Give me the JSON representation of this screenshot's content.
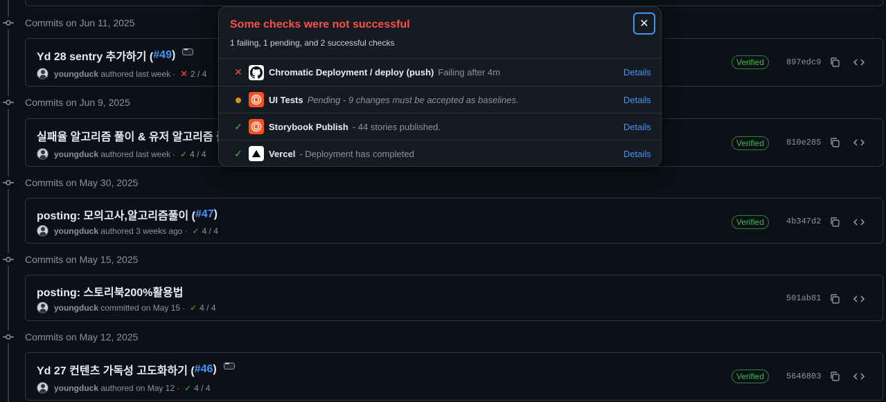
{
  "groups": [
    {
      "label": "Commits on Jun 11, 2025"
    },
    {
      "label": "Commits on Jun 9, 2025"
    },
    {
      "label": "Commits on May 30, 2025"
    },
    {
      "label": "Commits on May 15, 2025"
    },
    {
      "label": "Commits on May 12, 2025"
    }
  ],
  "commits": [
    {
      "title": "Yd 28 sentry 추가하기 (",
      "pr": "#49",
      "title_end": ")",
      "author": "youngduck",
      "action": "authored",
      "time": "last week",
      "sep": "·",
      "status": "fail",
      "checks": "2 / 4",
      "verified": "Verified",
      "sha": "897edc9"
    },
    {
      "title": "실패율 알고리즘 풀이 & 유저 알고리즘 풀",
      "pr": "",
      "title_end": "",
      "author": "youngduck",
      "action": "authored",
      "time": "last week",
      "sep": "·",
      "status": "success",
      "checks": "4 / 4",
      "verified": "Verified",
      "sha": "810e285"
    },
    {
      "title": "posting: 모의고사,알고리즘풀이 (",
      "pr": "#47",
      "title_end": ")",
      "author": "youngduck",
      "action": "authored",
      "time": "3 weeks ago",
      "sep": "·",
      "status": "success",
      "checks": "4 / 4",
      "verified": "Verified",
      "sha": "4b347d2"
    },
    {
      "title": "posting: 스토리북200%활용법",
      "pr": "",
      "title_end": "",
      "author": "youngduck",
      "action": "committed",
      "time": "on May 15",
      "sep": "·",
      "status": "success",
      "checks": "4 / 4",
      "verified": "",
      "sha": "501ab81"
    },
    {
      "title": "Yd 27 컨텐츠 가독성 고도화하기 (",
      "pr": "#46",
      "title_end": ")",
      "author": "youngduck",
      "action": "authored",
      "time": "on May 12",
      "sep": "·",
      "status": "success",
      "checks": "4 / 4",
      "verified": "Verified",
      "sha": "5646803"
    }
  ],
  "popover": {
    "title": "Some checks were not successful",
    "subtitle": "1 failing, 1 pending, and 2 successful checks",
    "close_icon": "x-icon",
    "checks": [
      {
        "status": "fail",
        "icon": "github-icon",
        "name": "Chromatic Deployment / deploy (push)",
        "desc": "Failing after 4m",
        "italic": false,
        "details": "Details"
      },
      {
        "status": "pending",
        "icon": "chromatic-icon",
        "name": "UI Tests",
        "desc": "Pending - 9 changes must be accepted as baselines.",
        "italic": true,
        "details": "Details"
      },
      {
        "status": "success",
        "icon": "chromatic-icon",
        "name": "Storybook Publish",
        "desc": "- 44 stories published.",
        "italic": false,
        "details": "Details"
      },
      {
        "status": "success",
        "icon": "vercel-icon",
        "name": "Vercel",
        "desc": "- Deployment has completed",
        "italic": false,
        "details": "Details"
      }
    ]
  },
  "colors": {
    "fail": "#f85149",
    "pending": "#d29922",
    "success": "#3fb950",
    "link": "#4493f8",
    "verified": "#3fb950"
  }
}
